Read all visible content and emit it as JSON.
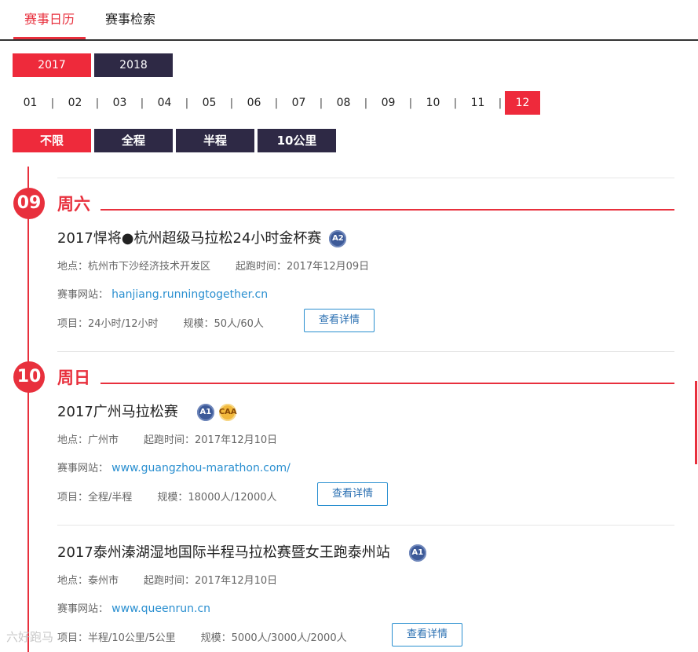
{
  "tabs": [
    {
      "label": "赛事日历",
      "active": true
    },
    {
      "label": "赛事检索",
      "active": false
    }
  ],
  "years": [
    {
      "label": "2017",
      "active": true
    },
    {
      "label": "2018",
      "active": false
    }
  ],
  "months": [
    "01",
    "02",
    "03",
    "04",
    "05",
    "06",
    "07",
    "08",
    "09",
    "10",
    "11",
    "12"
  ],
  "active_month": "12",
  "month_separator": "|",
  "distance_filters": [
    {
      "label": "不限",
      "active": true
    },
    {
      "label": "全程",
      "active": false
    },
    {
      "label": "半程",
      "active": false
    },
    {
      "label": "10公里",
      "active": false
    }
  ],
  "days": [
    {
      "day": "09",
      "weekday": "周六",
      "events": [
        {
          "title": "2017悍将●杭州超级马拉松24小时金杯赛",
          "badges": [
            "A2"
          ],
          "location": "地点：杭州市下沙经济技术开发区",
          "start": "起跑时间：2017年12月09日",
          "website_label": "赛事网站：",
          "website": "hanjiang.runningtogether.cn",
          "items": "项目：24小时/12小时",
          "scale": "规模：50人/60人",
          "detail_label": "查看详情"
        }
      ]
    },
    {
      "day": "10",
      "weekday": "周日",
      "events": [
        {
          "title": "2017广州马拉松赛",
          "badges": [
            "A1",
            "CAA"
          ],
          "location": "地点：广州市",
          "start": "起跑时间：2017年12月10日",
          "website_label": "赛事网站：",
          "website": "www.guangzhou-marathon.com/",
          "items": "项目：全程/半程",
          "scale": "规模：18000人/12000人",
          "detail_label": "查看详情"
        },
        {
          "title": "2017泰州溱湖湿地国际半程马拉松赛暨女王跑泰州站",
          "badges": [
            "A1"
          ],
          "location": "地点：泰州市",
          "start": "起跑时间：2017年12月10日",
          "website_label": "赛事网站：",
          "website": "www.queenrun.cn",
          "items": "项目：半程/10公里/5公里",
          "scale": "规模：5000人/3000人/2000人",
          "detail_label": "查看详情"
        }
      ]
    }
  ],
  "watermark": "六好跑马",
  "colors": {
    "accent": "#e8303d",
    "dark_chip": "#2e2945",
    "link": "#2a8fd0"
  }
}
